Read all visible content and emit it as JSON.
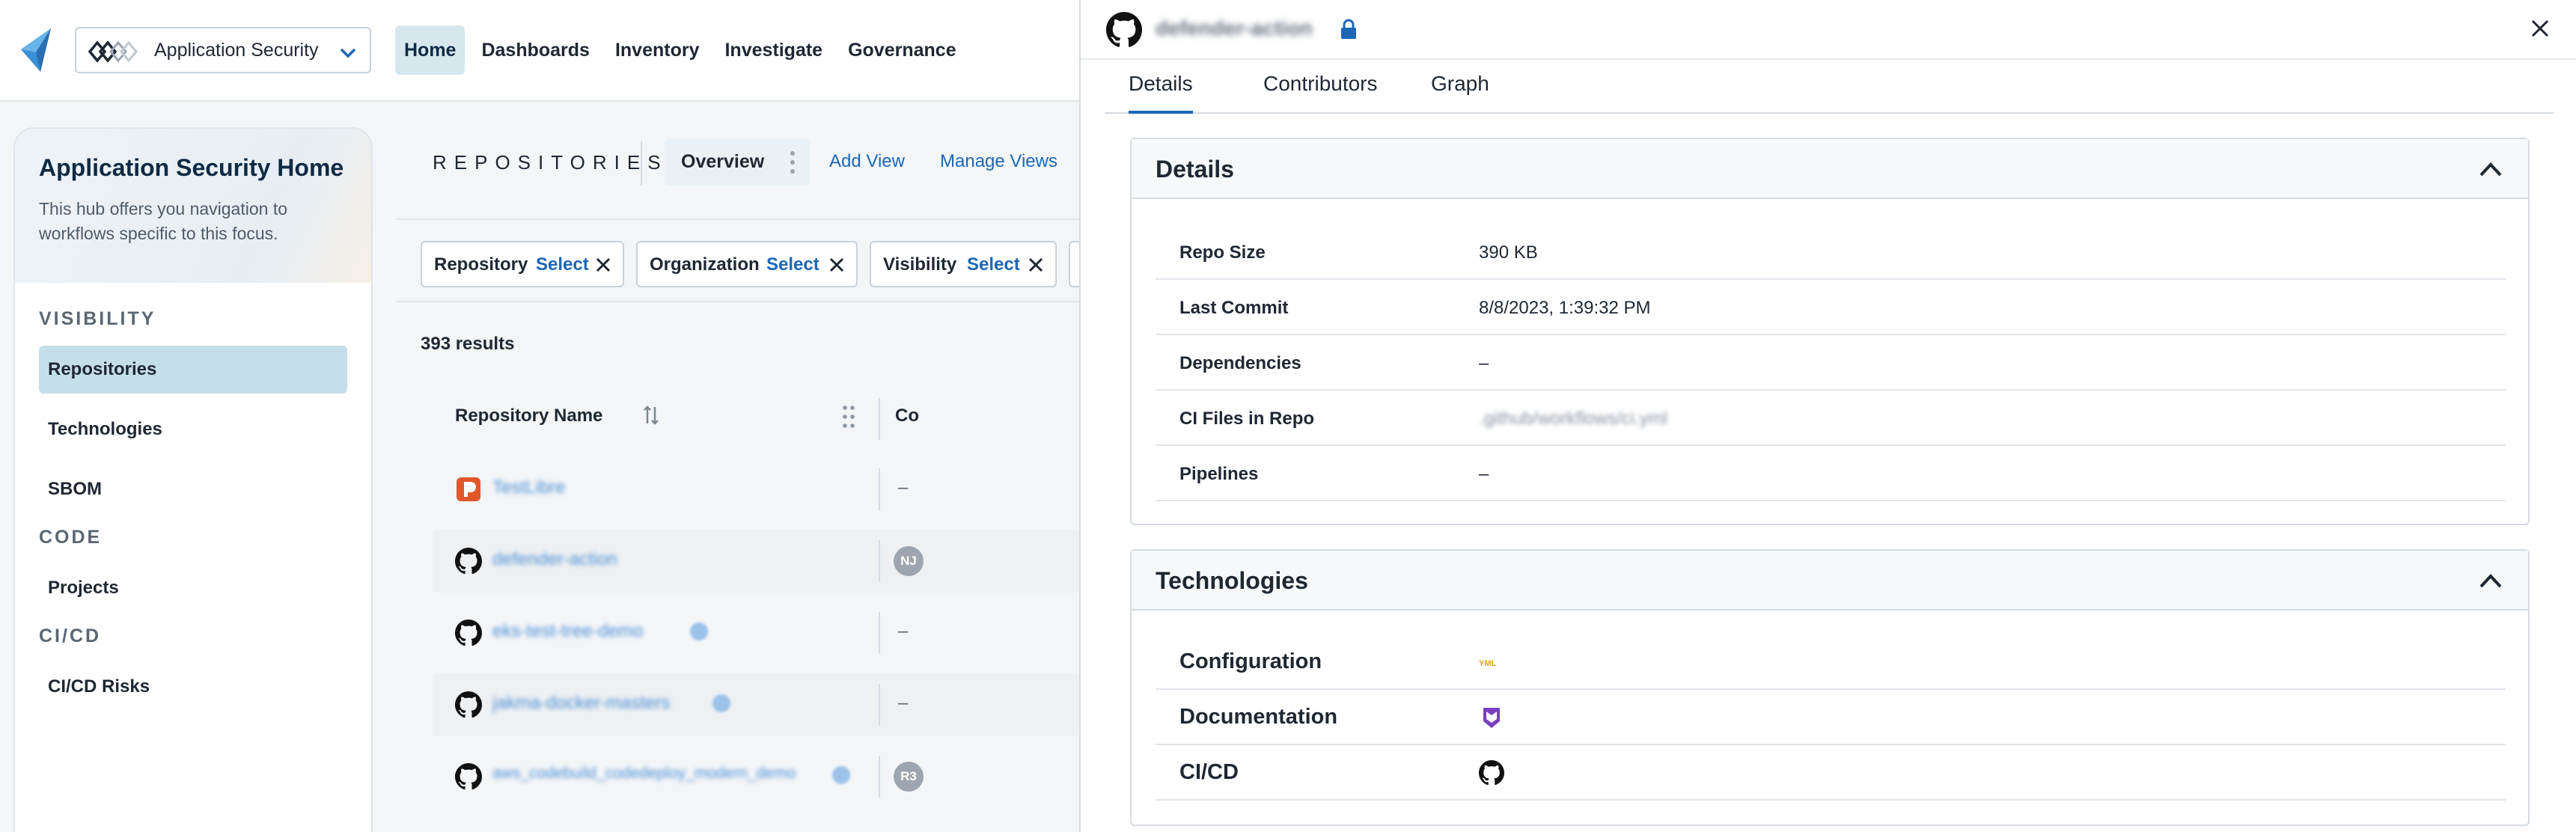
{
  "topbar": {
    "app_name": "Application Security",
    "nav": [
      "Home",
      "Dashboards",
      "Inventory",
      "Investigate",
      "Governance"
    ],
    "active_nav": "Home"
  },
  "sidebar": {
    "title": "Application Security Home",
    "description": "This hub offers you navigation to workflows specific to this focus.",
    "sections": [
      {
        "label": "VISIBILITY",
        "items": [
          "Repositories",
          "Technologies",
          "SBOM"
        ]
      },
      {
        "label": "CODE",
        "items": [
          "Projects"
        ]
      },
      {
        "label": "CI/CD",
        "items": [
          "CI/CD Risks"
        ]
      }
    ],
    "active_item": "Repositories"
  },
  "main": {
    "kicker": "REPOSITORIES",
    "view": "Overview",
    "add_view": "Add View",
    "manage_views": "Manage Views",
    "filters": [
      {
        "key": "Repository",
        "value": "Select"
      },
      {
        "key": "Organization",
        "value": "Select"
      },
      {
        "key": "Visibility",
        "value": "Select"
      }
    ],
    "results": "393 results",
    "columns": [
      "Repository Name",
      "Co"
    ],
    "rows": [
      {
        "icon": "repo-app-icon",
        "name": "TestLibre",
        "contrib": "–",
        "badge": false
      },
      {
        "icon": "github-icon",
        "name": "defender-action",
        "contrib": "NJ",
        "badge": false
      },
      {
        "icon": "github-icon",
        "name": "eks-test-tree-demo",
        "contrib": "–",
        "badge": true
      },
      {
        "icon": "github-icon",
        "name": "jakma-docker-masters",
        "contrib": "–",
        "badge": true
      },
      {
        "icon": "github-icon",
        "name": "aws_codebuild_codedeploy_modern_demo",
        "contrib": "R3",
        "badge": true
      }
    ]
  },
  "drawer": {
    "repo_name": "defender-action",
    "tabs": [
      "Details",
      "Contributors",
      "Graph"
    ],
    "active_tab": "Details",
    "details": {
      "heading": "Details",
      "rows": [
        {
          "key": "Repo Size",
          "value": "390 KB",
          "blurred": false
        },
        {
          "key": "Last Commit",
          "value": "8/8/2023, 1:39:32 PM",
          "blurred": false
        },
        {
          "key": "Dependencies",
          "value": "–",
          "blurred": false
        },
        {
          "key": "CI Files in Repo",
          "value": ".github/workflows/ci.yml",
          "blurred": true
        },
        {
          "key": "Pipelines",
          "value": "–",
          "blurred": false
        }
      ]
    },
    "technologies": {
      "heading": "Technologies",
      "rows": [
        {
          "key": "Configuration",
          "icon": "yaml-icon"
        },
        {
          "key": "Documentation",
          "icon": "markdown-shield-icon"
        },
        {
          "key": "CI/CD",
          "icon": "github-icon"
        }
      ]
    },
    "colors": {
      "accent": "#1d67b4",
      "active_nav_bg": "#d6e8ee",
      "active_item_bg": "#c5dfe8"
    }
  }
}
